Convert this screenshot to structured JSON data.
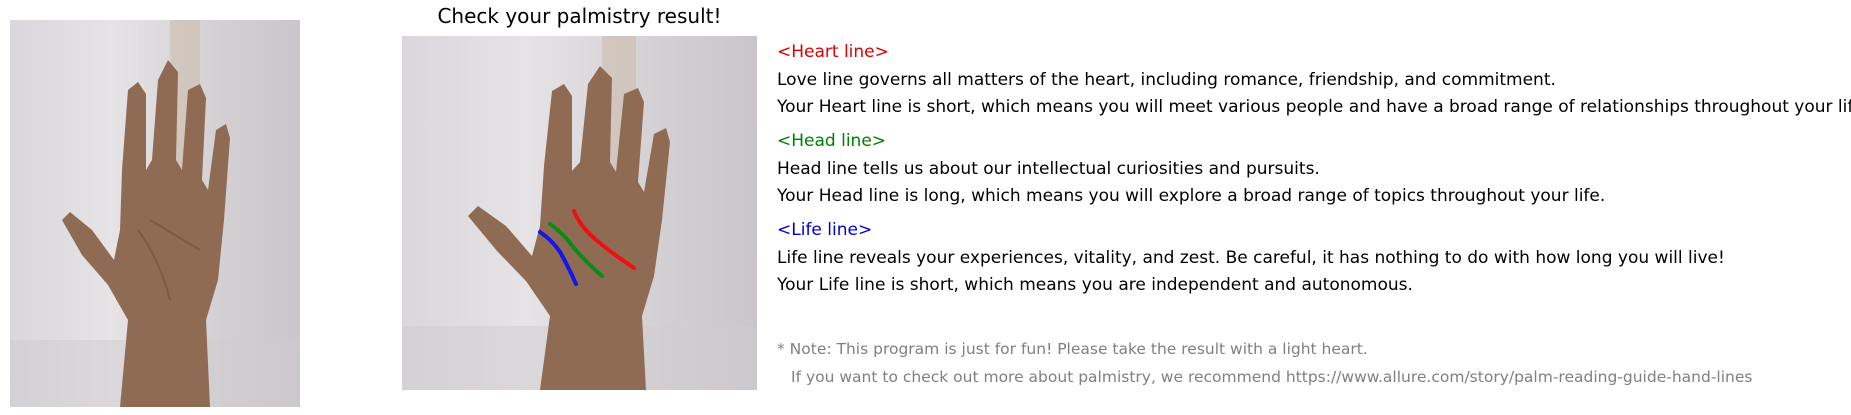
{
  "title": "Check your palmistry result!",
  "images": {
    "original": {
      "icon": "open-palm-photo"
    },
    "annotated": {
      "icon": "open-palm-photo-with-lines"
    }
  },
  "colors": {
    "heart": "#dd0000",
    "head": "#008000",
    "life": "#0000cc",
    "note": "#808080",
    "text": "#000000"
  },
  "sections": {
    "heart": {
      "heading": "<Heart line>",
      "description": "Love line governs all matters of the heart, including romance, friendship, and commitment.",
      "result": "Your Heart line is short, which means you will meet various people and have a broad range of relationships throughout your life."
    },
    "head": {
      "heading": "<Head line>",
      "description": "Head line tells us about our intellectual curiosities and pursuits.",
      "result": "Your Head line is long, which means you will explore a broad range of topics throughout your life."
    },
    "life": {
      "heading": "<Life line>",
      "description": "Life line reveals your experiences, vitality, and zest. Be careful, it has nothing to do with how long you will live!",
      "result": "Your Life line is short, which means you are independent and autonomous."
    }
  },
  "note": {
    "line1": "* Note: This program is just for fun! Please take the result with a light heart.",
    "line2": "If you want to check out more about palmistry, we recommend https://www.allure.com/story/palm-reading-guide-hand-lines"
  }
}
